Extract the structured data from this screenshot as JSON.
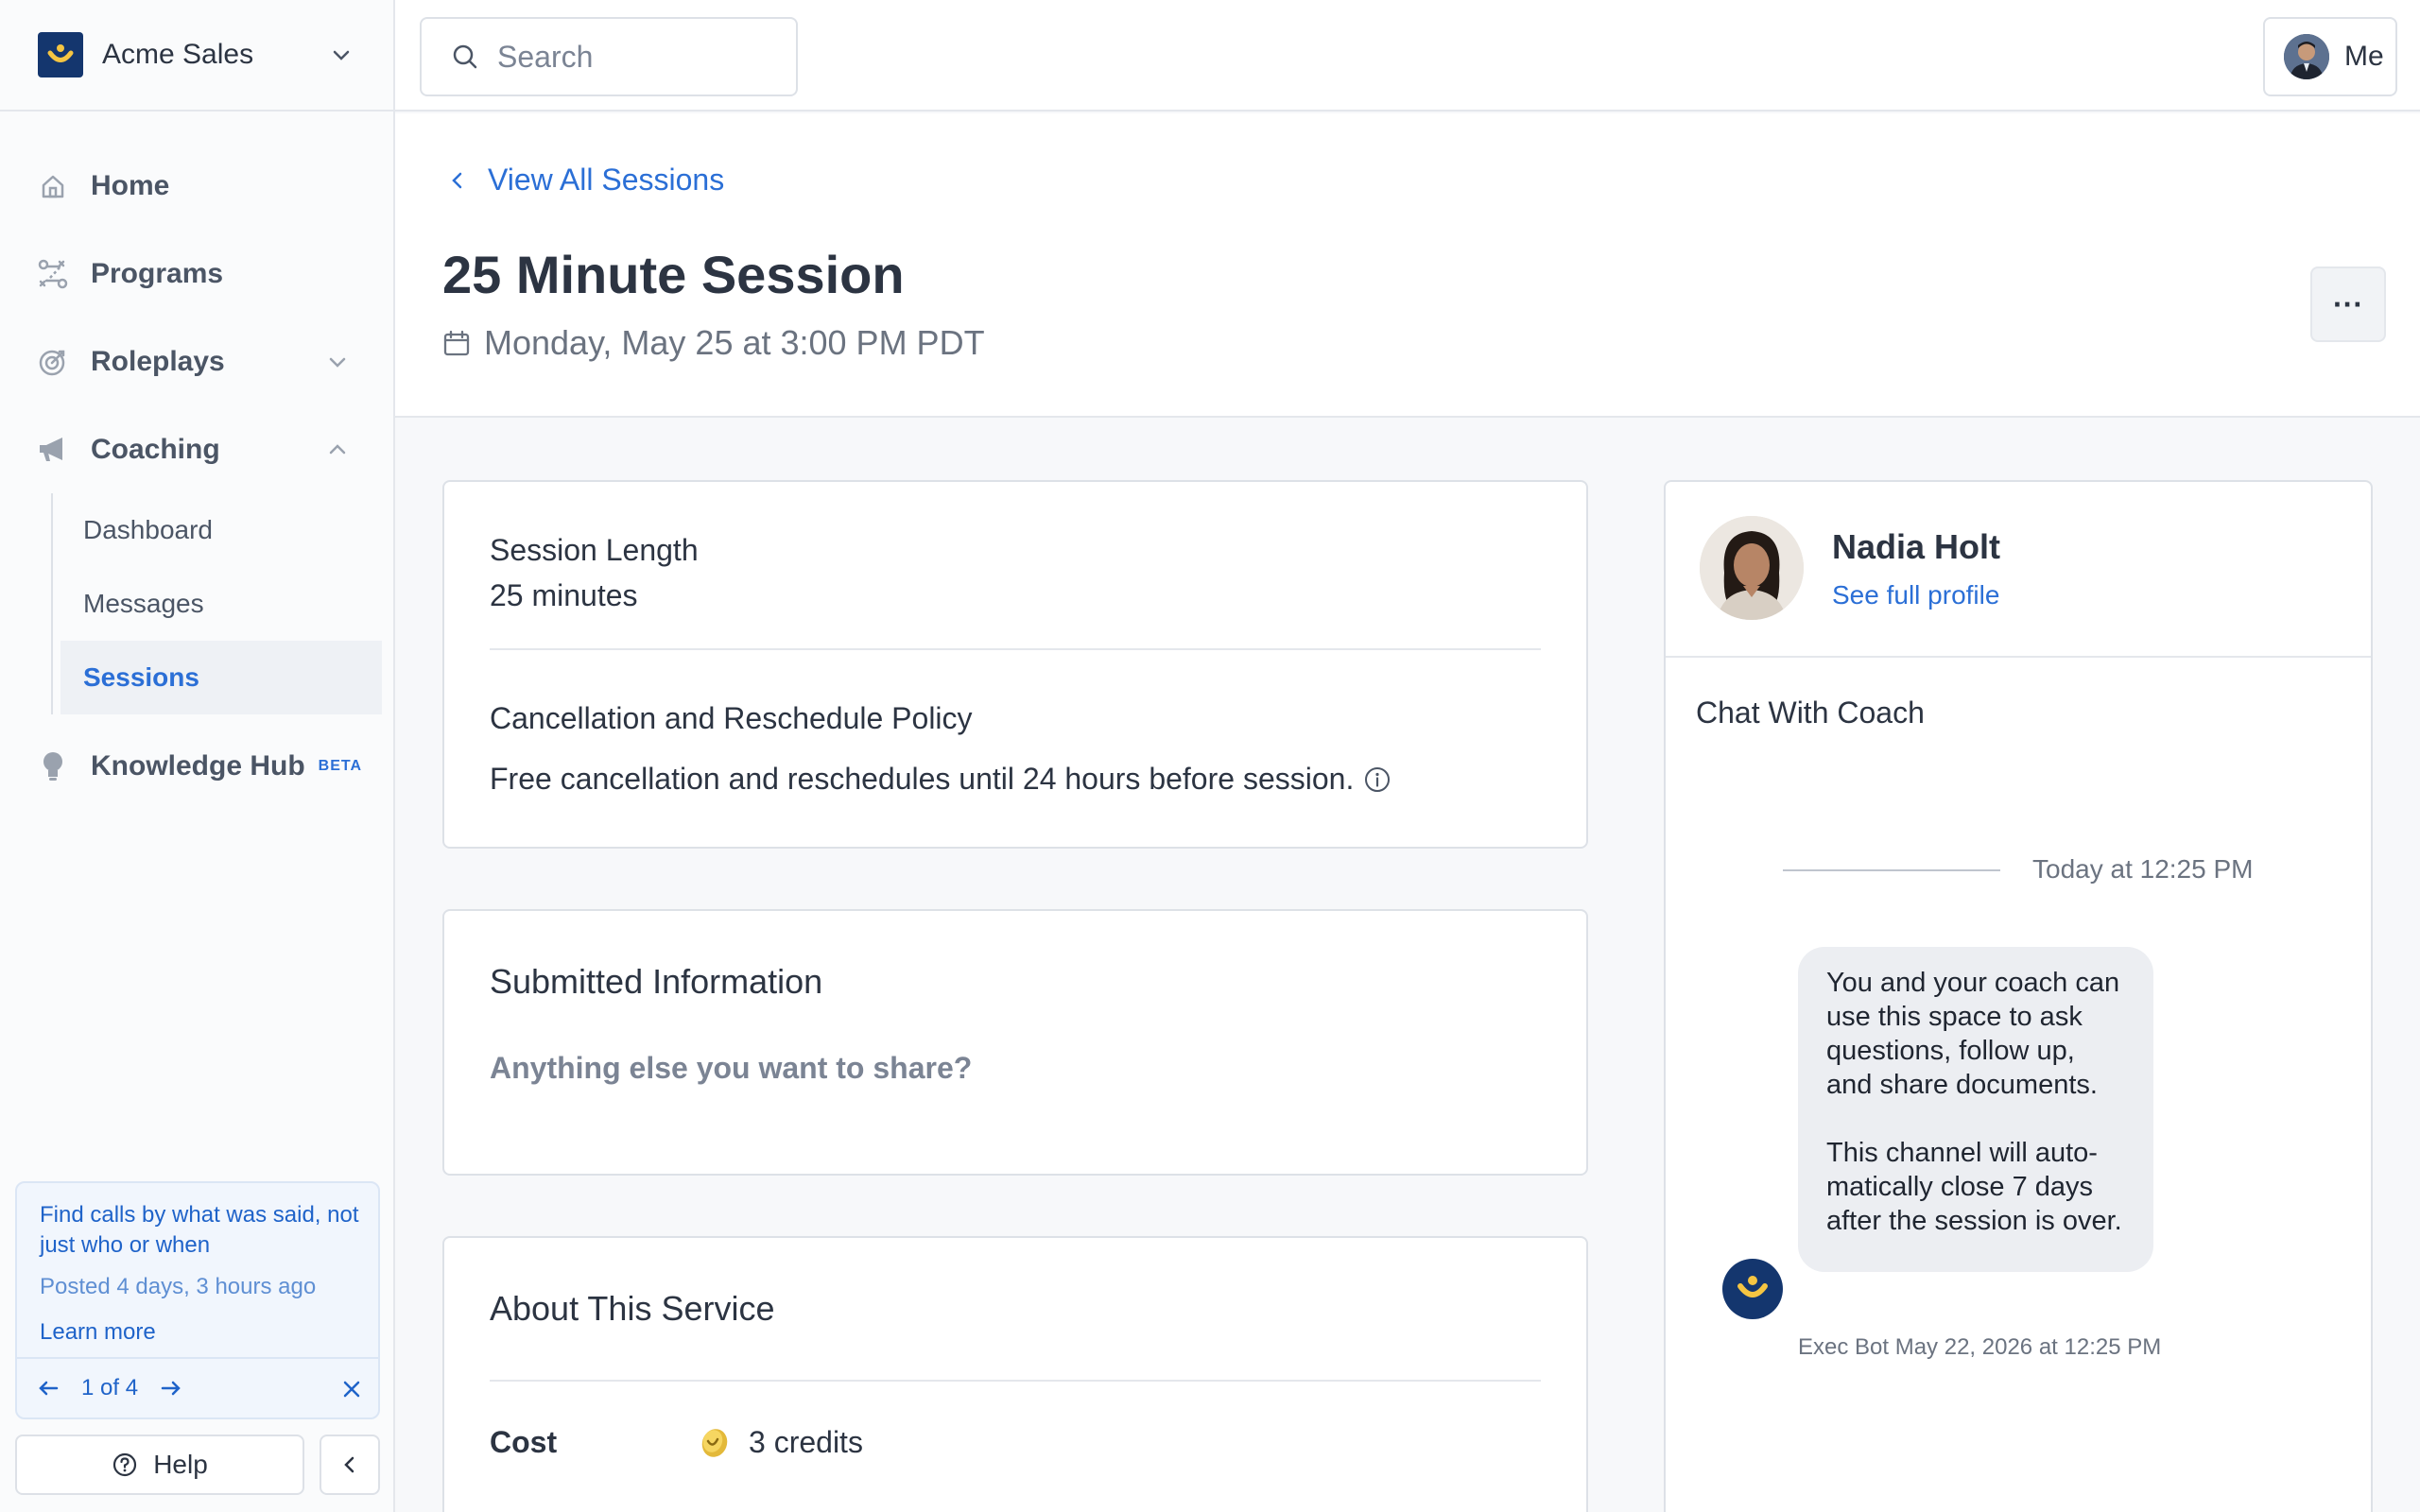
{
  "org": {
    "name": "Acme Sales"
  },
  "nav": {
    "home": "Home",
    "programs": "Programs",
    "roleplays": "Roleplays",
    "coaching": "Coaching",
    "coaching_sub": {
      "dashboard": "Dashboard",
      "messages": "Messages",
      "sessions": "Sessions"
    },
    "knowledge_hub": "Knowledge Hub",
    "beta_badge": "BETA"
  },
  "promo": {
    "title": "Find calls by what was said, not just who or when",
    "posted": "Posted 4 days, 3 hours ago",
    "link": "Learn more",
    "pager": "1 of 4"
  },
  "help": {
    "label": "Help"
  },
  "topbar": {
    "search_placeholder": "Search",
    "me_label": "Me"
  },
  "header": {
    "back_label": "View All Sessions",
    "title": "25 Minute Session",
    "date": "Monday, May 25 at 3:00 PM PDT",
    "more_label": "···"
  },
  "session": {
    "length_label": "Session Length",
    "length_value": "25 minutes",
    "policy_label": "Cancellation and Reschedule Policy",
    "policy_value": "Free cancellation and reschedules until 24 hours before session."
  },
  "submitted": {
    "title": "Submitted Information",
    "question": "Anything else you want to share?"
  },
  "about": {
    "title": "About This Service",
    "cost_label": "Cost",
    "cost_value": "3 credits"
  },
  "coach": {
    "name": "Nadia Holt",
    "profile_link": "See full profile",
    "chat_title": "Chat With Coach",
    "separator": "Today at 12:25 PM",
    "message_p1": "You and your coach can use this space to ask questions, follow up, and share documents.",
    "message_p2": "This channel will auto-matically close 7 days after the session is over.",
    "message_meta": "Exec Bot May 22, 2026 at 12:25 PM"
  },
  "colors": {
    "brand": "#14366e",
    "accent": "#2b6fd6",
    "logo_smile": "#f5c542"
  }
}
